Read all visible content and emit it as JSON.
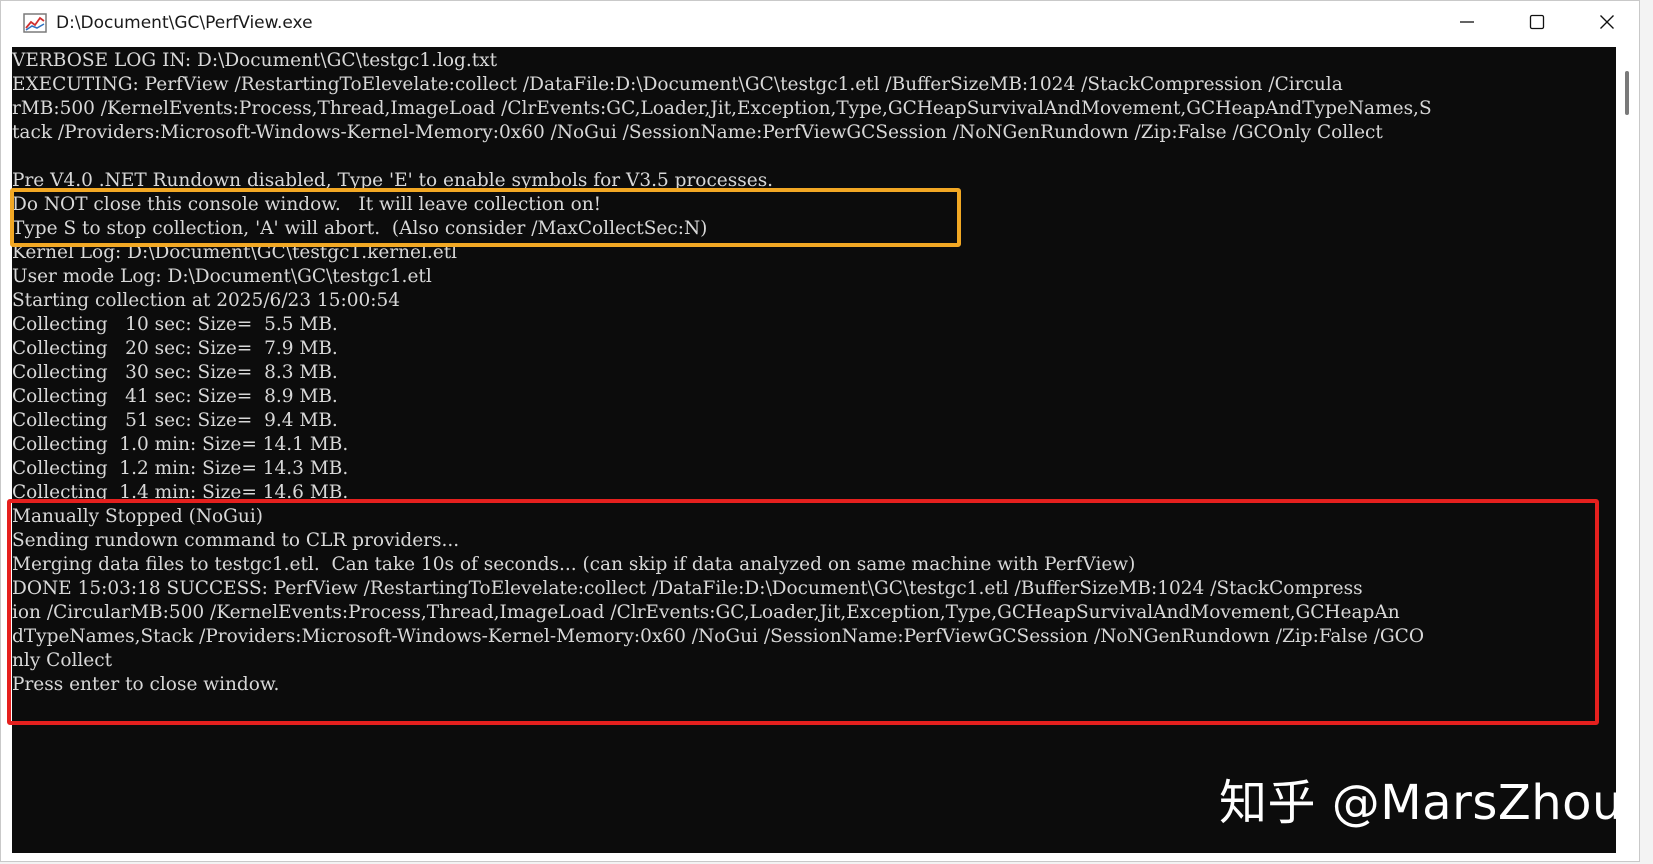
{
  "window": {
    "title": "D:\\Document\\GC\\PerfView.exe",
    "icon": "perfview-chart-icon"
  },
  "caption_buttons": {
    "minimize": "minimize-icon",
    "maximize": "maximize-icon",
    "close": "close-icon"
  },
  "console": {
    "lines": [
      "VERBOSE LOG IN: D:\\Document\\GC\\testgc1.log.txt",
      "EXECUTING: PerfView /RestartingToElevelate:collect /DataFile:D:\\Document\\GC\\testgc1.etl /BufferSizeMB:1024 /StackCompression /Circula",
      "rMB:500 /KernelEvents:Process,Thread,ImageLoad /ClrEvents:GC,Loader,Jit,Exception,Type,GCHeapSurvivalAndMovement,GCHeapAndTypeNames,S",
      "tack /Providers:Microsoft-Windows-Kernel-Memory:0x60 /NoGui /SessionName:PerfViewGCSession /NoNGenRundown /Zip:False /GCOnly Collect",
      "",
      "Pre V4.0 .NET Rundown disabled, Type 'E' to enable symbols for V3.5 processes.",
      "Do NOT close this console window.   It will leave collection on!",
      "Type S to stop collection, 'A' will abort.  (Also consider /MaxCollectSec:N)",
      "Kernel Log: D:\\Document\\GC\\testgc1.kernel.etl",
      "User mode Log: D:\\Document\\GC\\testgc1.etl",
      "Starting collection at 2025/6/23 15:00:54",
      "Collecting   10 sec: Size=  5.5 MB.",
      "Collecting   20 sec: Size=  7.9 MB.",
      "Collecting   30 sec: Size=  8.3 MB.",
      "Collecting   41 sec: Size=  8.9 MB.",
      "Collecting   51 sec: Size=  9.4 MB.",
      "Collecting  1.0 min: Size= 14.1 MB.",
      "Collecting  1.2 min: Size= 14.3 MB.",
      "Collecting  1.4 min: Size= 14.6 MB.",
      "Manually Stopped (NoGui)",
      "Sending rundown command to CLR providers...",
      "Merging data files to testgc1.etl.  Can take 10s of seconds... (can skip if data analyzed on same machine with PerfView)",
      "DONE 15:03:18 SUCCESS: PerfView /RestartingToElevelate:collect /DataFile:D:\\Document\\GC\\testgc1.etl /BufferSizeMB:1024 /StackCompress",
      "ion /CircularMB:500 /KernelEvents:Process,Thread,ImageLoad /ClrEvents:GC,Loader,Jit,Exception,Type,GCHeapSurvivalAndMovement,GCHeapAn",
      "dTypeNames,Stack /Providers:Microsoft-Windows-Kernel-Memory:0x60 /NoGui /SessionName:PerfViewGCSession /NoNGenRundown /Zip:False /GCO",
      "nly Collect",
      "Press enter to close window."
    ],
    "colors": {
      "background": "#0c0c0c",
      "text": "#d8d8d8"
    }
  },
  "annotations": {
    "yellow_box_color": "#f2a824",
    "red_box_color": "#e5201e"
  },
  "watermark": {
    "text": "知乎 @MarsZhou"
  }
}
